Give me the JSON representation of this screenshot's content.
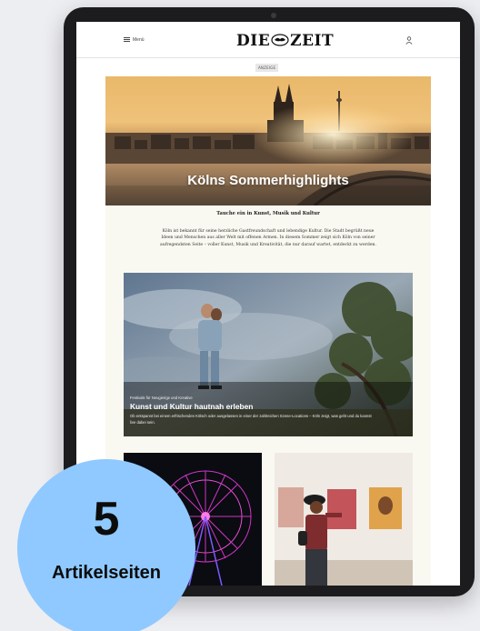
{
  "header": {
    "menu_label": "Menü",
    "logo_left": "DIE",
    "logo_right": "ZEIT"
  },
  "ad_label": "ANZEIGE",
  "hero": {
    "title": "Kölns Sommerhighlights"
  },
  "article": {
    "subtitle": "Tauche ein in Kunst, Musik und Kultur",
    "intro": "Köln ist bekannt für seine herzliche Gastfreundschaft und lebendige Kultur. Die Stadt begrüßt neue Ideen und Menschen aus aller Welt mit offenen Armen. In diesem Sommer zeigt sich Köln von seiner aufregendsten Seite – voller Kunst, Musik und Kreativität, die nur darauf wartet, entdeckt zu werden."
  },
  "feature": {
    "kicker": "Festivals für Neugierige und Kreative",
    "title": "Kunst und Kultur hautnah erleben",
    "text": "Ob entspannt bei einem erfrischenden Kölsch oder ausgelassen in einer der zahlreichen Szene-Locations – Köln zeigt, was geht und du kannst live dabei sein."
  },
  "badge": {
    "number": "5",
    "label": "Artikelseiten"
  },
  "colors": {
    "background": "#edeef2",
    "badge": "#8fc9ff",
    "content_bg": "#faf9f1"
  }
}
